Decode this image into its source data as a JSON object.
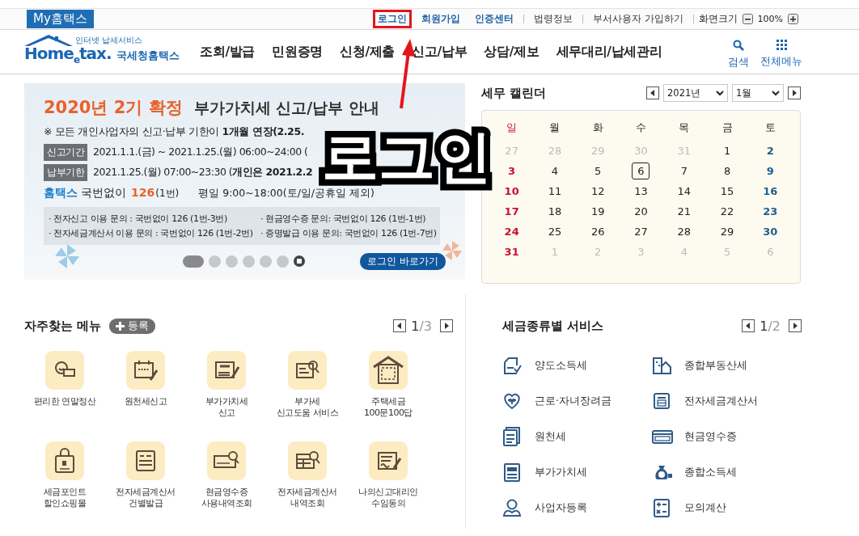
{
  "top_bar": {
    "my_tab": "My홈택스",
    "links": [
      {
        "label": "로그인",
        "kind": "primary",
        "highlighted": true
      },
      {
        "label": "회원가입",
        "kind": "primary",
        "highlighted": false
      },
      {
        "label": "인증센터",
        "kind": "primary",
        "highlighted": false
      },
      {
        "label": "법령정보",
        "kind": "plain",
        "highlighted": false
      },
      {
        "label": "부서사용자 가입하기",
        "kind": "plain",
        "highlighted": false
      }
    ],
    "zoom_label": "화면크기",
    "zoom_value": "100%"
  },
  "header": {
    "logo": {
      "tagline": "인터넷 납세서비스",
      "wordmark": "Home$_{e}$tax.",
      "name": "국세청홈택스"
    },
    "nav": [
      "조회/발급",
      "민원증명",
      "신청/제출",
      "신고/납부",
      "상담/제보",
      "세무대리/납세관리"
    ],
    "search": "검색",
    "all_menu": "전체메뉴"
  },
  "banner": {
    "title_highlight": "2020년 2기 확정",
    "title": "부가가치세 신고/납부 안내",
    "notice": "※ 모든 개인사업자의 신고·납부 기한이 **1개월 연장(2.25.**",
    "periods": [
      {
        "tag": "신고기간",
        "text": "2021.1.1.(금) ~ 2021.1.25.(월) 06:00~24:00 ("
      },
      {
        "tag": "납부기한",
        "text": "2021.1.25.(월) 07:00~23:30 (**개인은 2021.2.2**"
      }
    ],
    "phone": {
      "brand": "홈택스",
      "prefix": "국번없이",
      "number": "126",
      "ext": "(1번)",
      "hours": "평일 9:00~18:00(토/일/공휴일 제외)"
    },
    "inquiries": [
      "· 전자신고 이용 문의 : 국번없이 126 (1번-3번)",
      "· 현금영수증 문의: 국번없이 126 (1번-1번)",
      "· 전자세금계산서 이용 문의 : 국번없이 126 (1번-2번)",
      "· 증명발급 이용 문의: 국번없이 126 (1번-7번)"
    ],
    "dots": [
      {
        "selected": true
      },
      {
        "selected": false
      },
      {
        "selected": false
      },
      {
        "selected": false
      },
      {
        "selected": false
      },
      {
        "selected": false
      }
    ],
    "login_button": "로그인 바로가기"
  },
  "annotation": {
    "text": "로그인"
  },
  "calendar": {
    "title": "세무 캘린더",
    "year": "2021년",
    "month": "1월",
    "weekdays": [
      "일",
      "월",
      "화",
      "수",
      "목",
      "금",
      "토"
    ],
    "weeks": [
      [
        {
          "day": "27",
          "muted": true,
          "selected": false
        },
        {
          "day": "28",
          "muted": true,
          "selected": false
        },
        {
          "day": "29",
          "muted": true,
          "selected": false
        },
        {
          "day": "30",
          "muted": true,
          "selected": false
        },
        {
          "day": "31",
          "muted": true,
          "selected": false
        },
        {
          "day": "1",
          "muted": false,
          "selected": false
        },
        {
          "day": "2",
          "muted": false,
          "selected": false
        }
      ],
      [
        {
          "day": "3",
          "muted": false,
          "selected": false
        },
        {
          "day": "4",
          "muted": false,
          "selected": false
        },
        {
          "day": "5",
          "muted": false,
          "selected": false
        },
        {
          "day": "6",
          "muted": false,
          "selected": true
        },
        {
          "day": "7",
          "muted": false,
          "selected": false
        },
        {
          "day": "8",
          "muted": false,
          "selected": false
        },
        {
          "day": "9",
          "muted": false,
          "selected": false
        }
      ],
      [
        {
          "day": "10",
          "muted": false,
          "selected": false
        },
        {
          "day": "11",
          "muted": false,
          "selected": false
        },
        {
          "day": "12",
          "muted": false,
          "selected": false
        },
        {
          "day": "13",
          "muted": false,
          "selected": false
        },
        {
          "day": "14",
          "muted": false,
          "selected": false
        },
        {
          "day": "15",
          "muted": false,
          "selected": false
        },
        {
          "day": "16",
          "muted": false,
          "selected": false
        }
      ],
      [
        {
          "day": "17",
          "muted": false,
          "selected": false
        },
        {
          "day": "18",
          "muted": false,
          "selected": false
        },
        {
          "day": "19",
          "muted": false,
          "selected": false
        },
        {
          "day": "20",
          "muted": false,
          "selected": false
        },
        {
          "day": "21",
          "muted": false,
          "selected": false
        },
        {
          "day": "22",
          "muted": false,
          "selected": false
        },
        {
          "day": "23",
          "muted": false,
          "selected": false
        }
      ],
      [
        {
          "day": "24",
          "muted": false,
          "selected": false
        },
        {
          "day": "25",
          "muted": false,
          "selected": false
        },
        {
          "day": "26",
          "muted": false,
          "selected": false
        },
        {
          "day": "27",
          "muted": false,
          "selected": false
        },
        {
          "day": "28",
          "muted": false,
          "selected": false
        },
        {
          "day": "29",
          "muted": false,
          "selected": false
        },
        {
          "day": "30",
          "muted": false,
          "selected": false
        }
      ],
      [
        {
          "day": "31",
          "muted": false,
          "selected": false
        },
        {
          "day": "1",
          "muted": true,
          "selected": false
        },
        {
          "day": "2",
          "muted": true,
          "selected": false
        },
        {
          "day": "3",
          "muted": true,
          "selected": false
        },
        {
          "day": "4",
          "muted": true,
          "selected": false
        },
        {
          "day": "5",
          "muted": true,
          "selected": false
        },
        {
          "day": "6",
          "muted": true,
          "selected": false
        }
      ]
    ]
  },
  "favorites": {
    "title": "자주찾는 메뉴",
    "add_button": "등록",
    "page_current": "1",
    "page_rest": "/3",
    "items": [
      "편리한 연말정산",
      "원천세신고",
      "부가가치세\n신고",
      "부가세\n신고도움 서비스",
      "주택세금\n100문100답",
      "세금포인트\n할인쇼핑몰",
      "전자세금계산서\n건별발급",
      "현금영수증\n사용내역조회",
      "전자세금계산서\n내역조회",
      "나의신고대리인\n수임동의"
    ]
  },
  "tax_services": {
    "title": "세금종류별 서비스",
    "page_current": "1",
    "page_rest": "/2",
    "items": [
      "양도소득세",
      "종합부동산세",
      "근로·자녀장려금",
      "전자세금계산서",
      "원천세",
      "현금영수증",
      "부가가치세",
      "종합소득세",
      "사업자등록",
      "모의계산"
    ]
  }
}
